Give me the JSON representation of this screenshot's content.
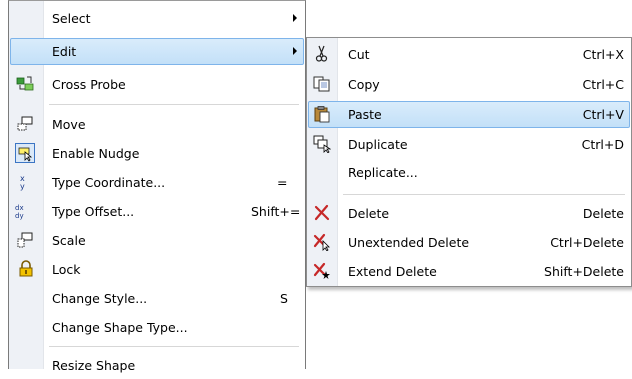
{
  "main_menu": {
    "items": [
      {
        "label": "Select",
        "shortcut": "",
        "submenu": true,
        "icon": ""
      },
      {
        "label": "Edit",
        "shortcut": "",
        "submenu": true,
        "icon": "",
        "highlighted": true
      },
      {
        "label": "Cross Probe",
        "shortcut": "",
        "icon": "cross-probe-icon"
      },
      {
        "label": "Move",
        "shortcut": "",
        "icon": "move-icon"
      },
      {
        "label": "Enable Nudge",
        "shortcut": "",
        "icon": "nudge-icon"
      },
      {
        "label": "Type Coordinate...",
        "shortcut": "=",
        "icon": "coordinate-icon"
      },
      {
        "label": "Type Offset...",
        "shortcut": "Shift+=",
        "icon": "offset-icon"
      },
      {
        "label": "Scale",
        "shortcut": "",
        "icon": "scale-icon"
      },
      {
        "label": "Lock",
        "shortcut": "",
        "icon": "lock-icon"
      },
      {
        "label": "Change Style...",
        "shortcut": "S",
        "icon": ""
      },
      {
        "label": "Change Shape Type...",
        "shortcut": "",
        "icon": ""
      },
      {
        "label": "Resize Shape",
        "shortcut": "",
        "icon": ""
      }
    ]
  },
  "edit_submenu": {
    "items": [
      {
        "label": "Cut",
        "shortcut": "Ctrl+X",
        "icon": "cut-icon"
      },
      {
        "label": "Copy",
        "shortcut": "Ctrl+C",
        "icon": "copy-icon"
      },
      {
        "label": "Paste",
        "shortcut": "Ctrl+V",
        "icon": "paste-icon",
        "highlighted": true
      },
      {
        "label": "Duplicate",
        "shortcut": "Ctrl+D",
        "icon": "duplicate-icon"
      },
      {
        "label": "Replicate...",
        "shortcut": "",
        "icon": ""
      },
      {
        "label": "Delete",
        "shortcut": "Delete",
        "icon": "delete-icon"
      },
      {
        "label": "Unextended Delete",
        "shortcut": "Ctrl+Delete",
        "icon": "unextended-delete-icon"
      },
      {
        "label": "Extend Delete",
        "shortcut": "Shift+Delete",
        "icon": "extend-delete-icon"
      }
    ]
  },
  "colors": {
    "highlight_fill": "#c9e3f9",
    "highlight_border": "#7eb4ea",
    "gutter": "#eef1f6",
    "delete_red": "#c62828"
  }
}
